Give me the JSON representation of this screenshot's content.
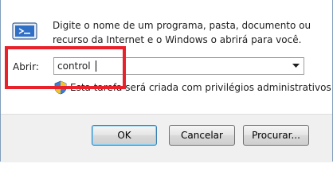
{
  "dialog": {
    "description": "Digite o nome de um programa, pasta, documento ou recurso da Internet e o Windows o abrirá para você.",
    "open_label": "Abrir:",
    "command_value": "control",
    "admin_note": "Esta tarefa será criada com privilégios administrativos.",
    "buttons": {
      "ok": "OK",
      "cancel": "Cancelar",
      "browse": "Procurar..."
    }
  },
  "icons": {
    "run": "run-dialog-icon",
    "shield": "uac-shield-icon",
    "dropdown": "chevron-down-icon"
  },
  "colors": {
    "highlight": "#e8212a",
    "footer_bg": "#f0f0f0",
    "default_button_border": "#3c7fb1"
  }
}
